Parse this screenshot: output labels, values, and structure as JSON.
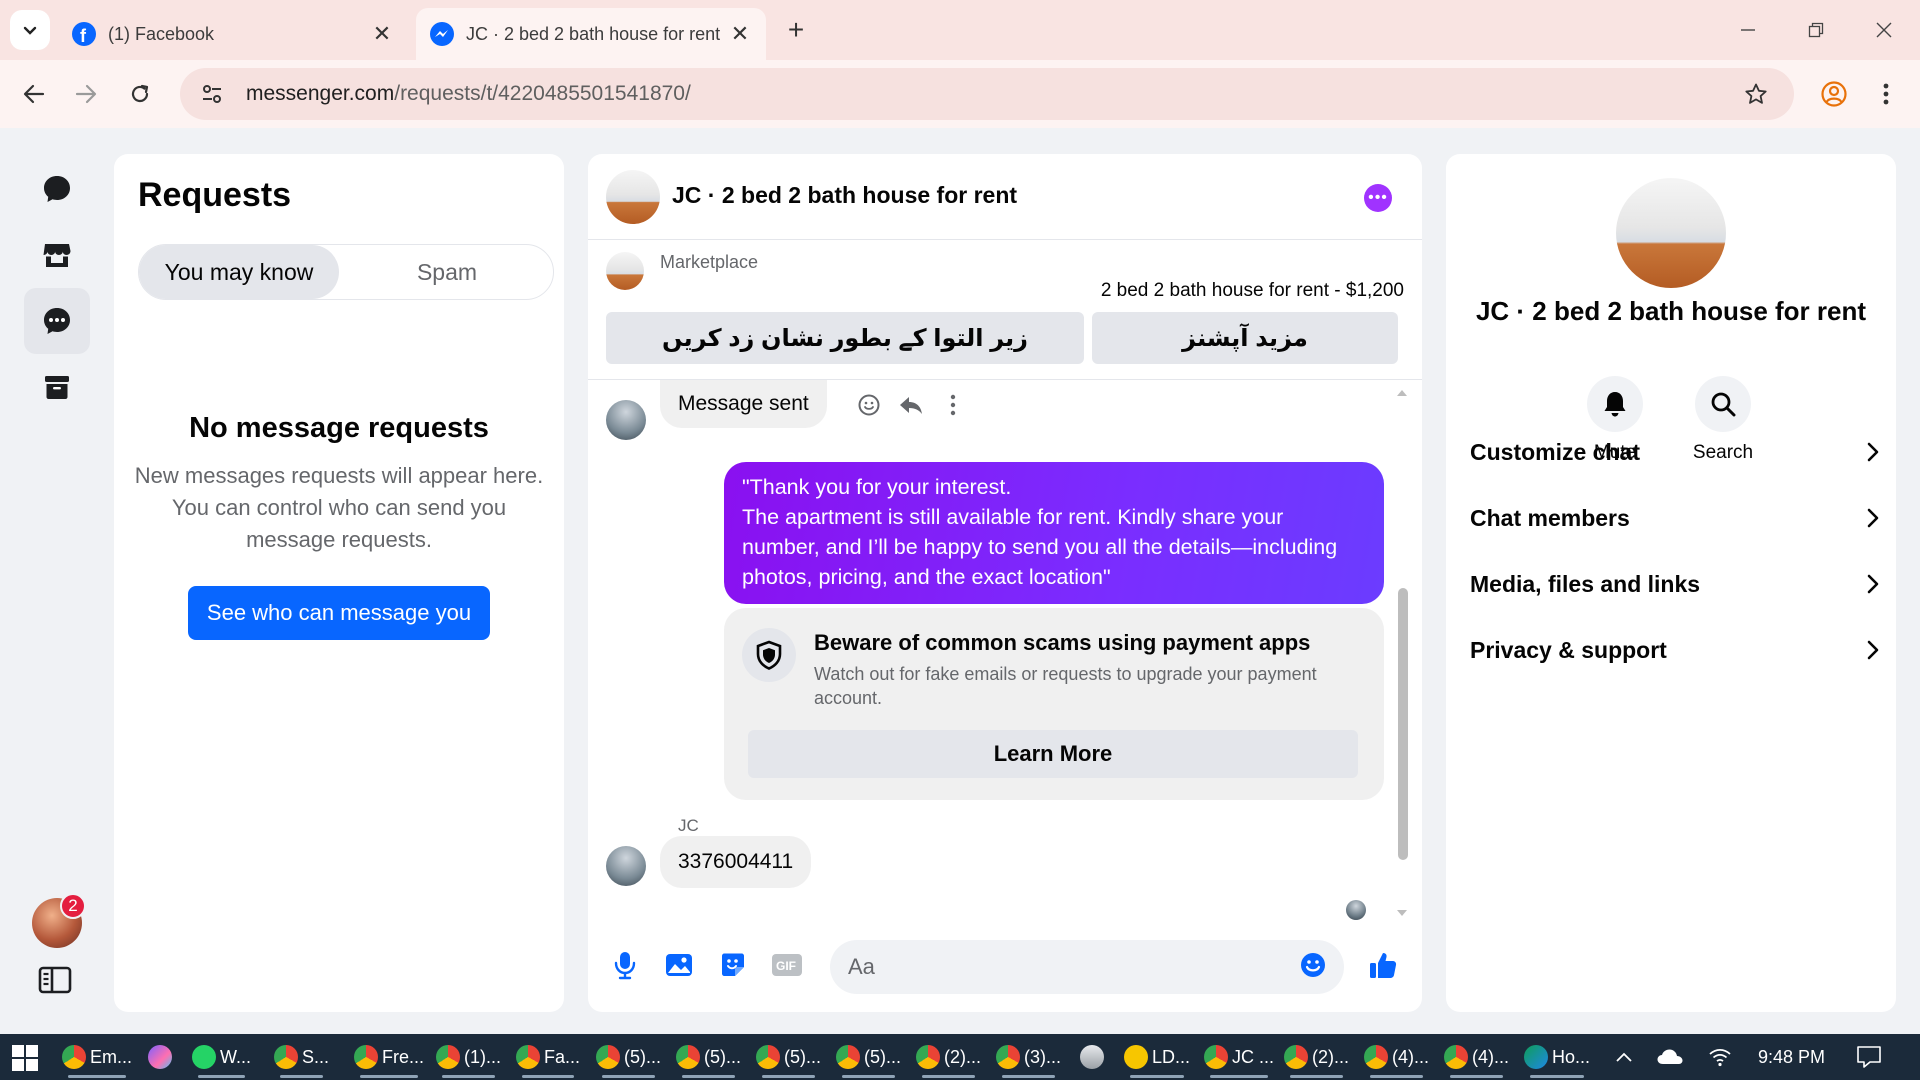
{
  "browser": {
    "tabs": [
      {
        "title": "(1) Facebook",
        "icon": "facebook-icon"
      },
      {
        "title": "JC · 2 bed 2 bath house for rent",
        "icon": "messenger-icon"
      }
    ],
    "url": {
      "host": "messenger.com",
      "path": "/requests/t/4220485501541870/"
    }
  },
  "requests": {
    "heading": "Requests",
    "tabs": {
      "selected": "You may know",
      "other": "Spam"
    },
    "empty_title": "No message requests",
    "empty_desc": "New messages requests will appear here. You can control who can send you message requests.",
    "cta": "See who can message you"
  },
  "rail": {
    "badge": "2"
  },
  "chat": {
    "title": "JC · 2 bed 2 bath house for rent",
    "marketplace_label": "Marketplace",
    "listing": "2 bed 2 bath house for rent - $1,200",
    "btn_mark_pending": "زیر التوا کے بطور نشان زد کریں",
    "btn_more_options": "مزید آپشنز",
    "messages": {
      "sent_notice": "Message sent",
      "outgoing": "\"Thank you for your interest.\nThe apartment is still available for rent. Kindly share your number, and I’ll be happy to send you all the details—including photos, pricing, and the exact location\"",
      "scam_title": "Beware of common scams using payment apps",
      "scam_body": "Watch out for fake emails or requests to upgrade your payment account.",
      "scam_button": "Learn More",
      "sender_name": "JC",
      "incoming": "3376004411"
    },
    "composer_placeholder": "Aa",
    "accent": "#0866ff",
    "bubble_color": "#8a10f0"
  },
  "info": {
    "title": "JC · 2 bed 2 bath house for rent",
    "actions": {
      "mute": "Mute",
      "search": "Search"
    },
    "rows": [
      "Customize chat",
      "Chat members",
      "Media, files and links",
      "Privacy & support"
    ]
  },
  "taskbar": {
    "items": [
      "Em...",
      "W...",
      "S...",
      "Fre...",
      "(1)...",
      "Fa...",
      "(5)...",
      "(5)...",
      "(5)...",
      "(5)...",
      "(2)...",
      "(3)...",
      "LD...",
      "JC ...",
      "(2)...",
      "(4)...",
      "(4)...",
      "Ho..."
    ],
    "time": "9:48 PM"
  }
}
